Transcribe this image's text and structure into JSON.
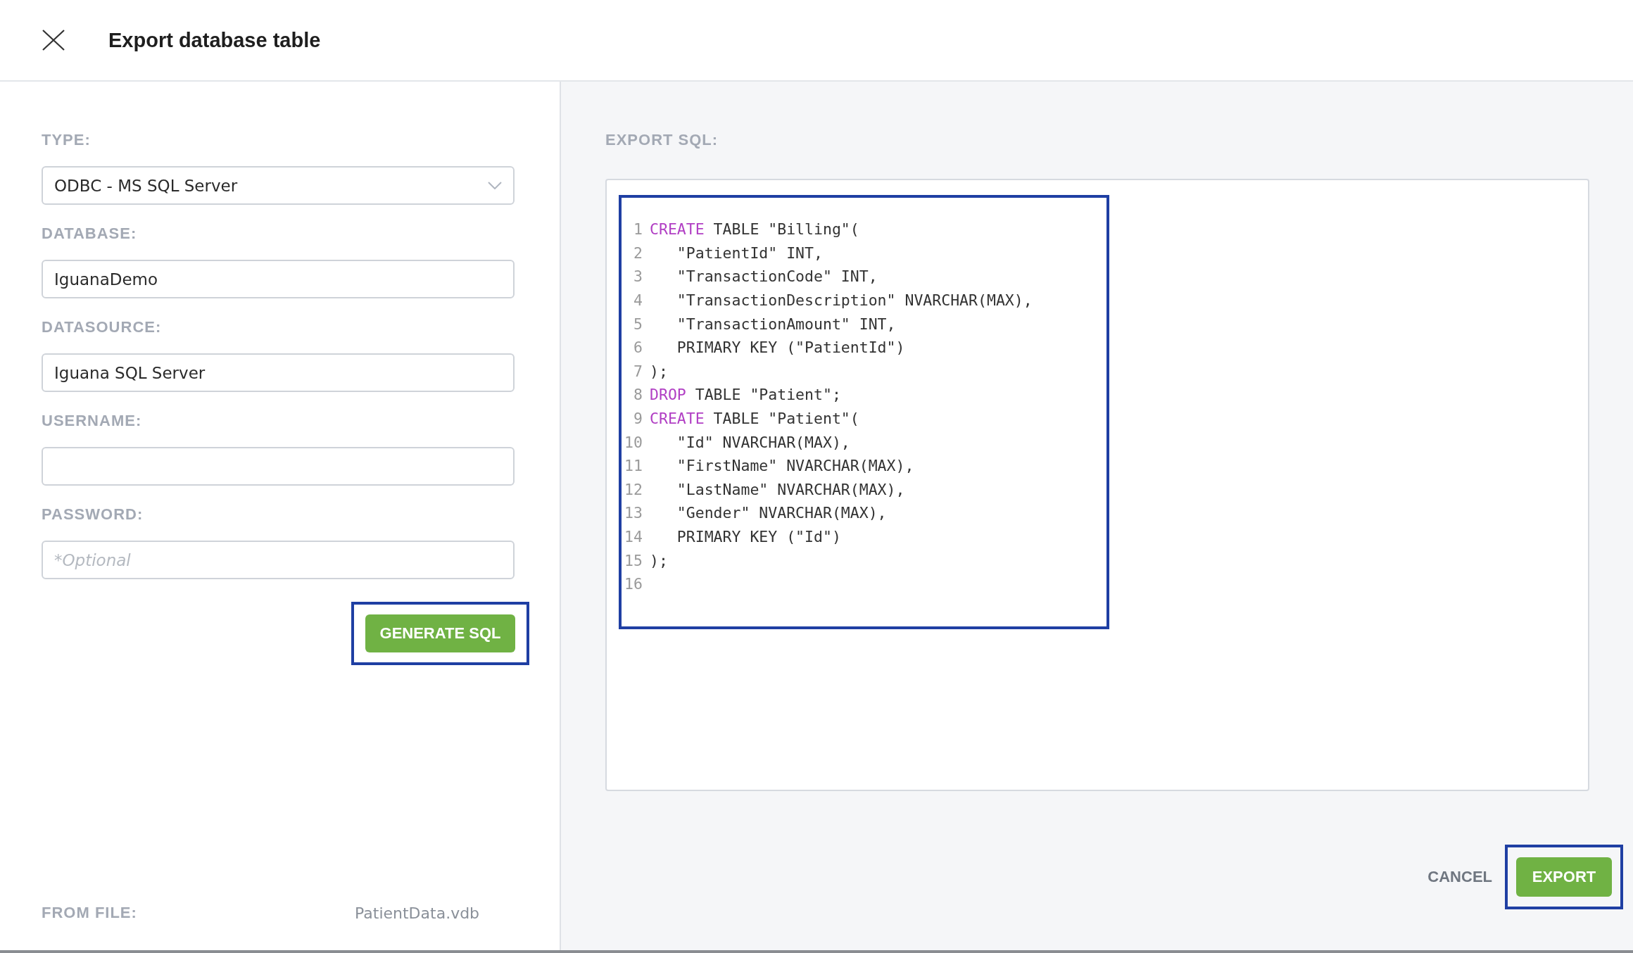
{
  "dialog": {
    "title": "Export database table"
  },
  "fields": [
    {
      "label": "TYPE:",
      "kind": "select",
      "value": "ODBC - MS SQL Server"
    },
    {
      "label": "DATABASE:",
      "kind": "text",
      "value": "IguanaDemo"
    },
    {
      "label": "DATASOURCE:",
      "kind": "text",
      "value": "Iguana SQL Server"
    },
    {
      "label": "USERNAME:",
      "kind": "text"
    },
    {
      "label": "PASSWORD:",
      "kind": "text",
      "placeholder": "*Optional"
    }
  ],
  "generate_button": {
    "label": "GENERATE SQL",
    "highlighted": true
  },
  "from_file": {
    "label": "FROM FILE:",
    "value": "PatientData.vdb"
  },
  "export_sql": {
    "label": "EXPORT SQL:",
    "highlighted": true,
    "lines": [
      {
        "number": "1",
        "keyword": "CREATE",
        "text": " TABLE \"Billing\"("
      },
      {
        "number": "2",
        "text": "   \"PatientId\" INT,"
      },
      {
        "number": "3",
        "text": "   \"TransactionCode\" INT,"
      },
      {
        "number": "4",
        "text": "   \"TransactionDescription\" NVARCHAR(MAX),"
      },
      {
        "number": "5",
        "text": "   \"TransactionAmount\" INT,"
      },
      {
        "number": "6",
        "text": "   PRIMARY KEY (\"PatientId\")"
      },
      {
        "number": "7",
        "text": ");"
      },
      {
        "number": "8",
        "keyword": "DROP",
        "text": " TABLE \"Patient\";"
      },
      {
        "number": "9",
        "keyword": "CREATE",
        "text": " TABLE \"Patient\"("
      },
      {
        "number": "10",
        "text": "   \"Id\" NVARCHAR(MAX),"
      },
      {
        "number": "11",
        "text": "   \"FirstName\" NVARCHAR(MAX),"
      },
      {
        "number": "12",
        "text": "   \"LastName\" NVARCHAR(MAX),"
      },
      {
        "number": "13",
        "text": "   \"Gender\" NVARCHAR(MAX),"
      },
      {
        "number": "14",
        "text": "   PRIMARY KEY (\"Id\")"
      },
      {
        "number": "15",
        "text": ");"
      },
      {
        "number": "16"
      }
    ]
  },
  "footer": {
    "cancel": "CANCEL",
    "export": {
      "label": "EXPORT",
      "highlighted": true
    }
  }
}
